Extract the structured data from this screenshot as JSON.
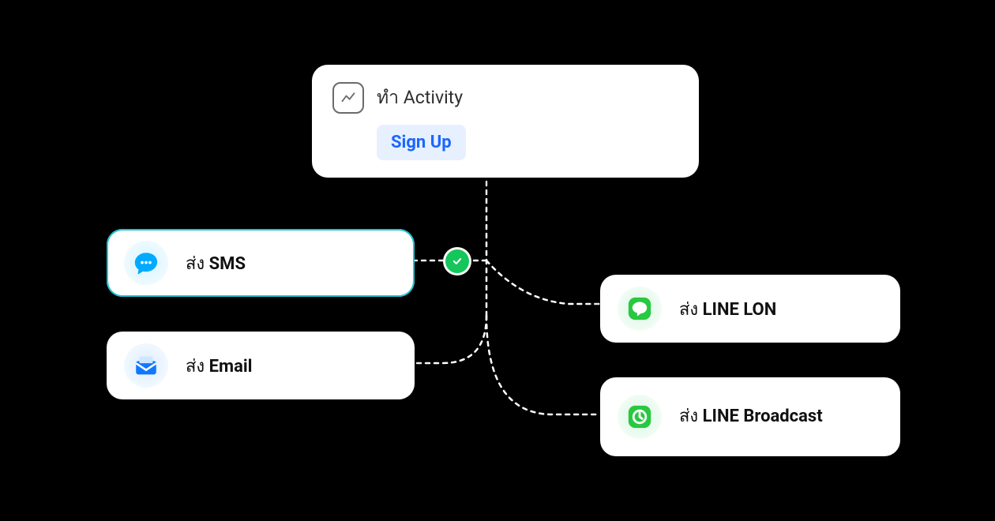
{
  "activity": {
    "title": "ทำ Activity",
    "badge": "Sign Up"
  },
  "channels": {
    "sms": {
      "verb": "ส่ง",
      "noun": "SMS"
    },
    "email": {
      "verb": "ส่ง",
      "noun": "Email"
    },
    "line_lon": {
      "verb": "ส่ง",
      "noun": "LINE LON"
    },
    "line_broadcast": {
      "verb": "ส่ง",
      "noun": "LINE Broadcast"
    }
  }
}
